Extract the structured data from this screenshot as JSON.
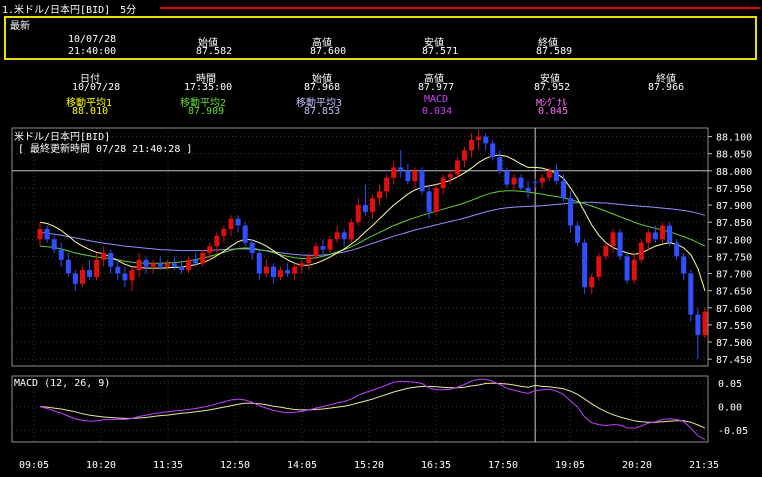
{
  "window": {
    "title": "1.米ドル/日本円[BID]　5分"
  },
  "latest": {
    "label": "最新",
    "date": "10/07/28",
    "time": "21:40:00",
    "open_label": "始値",
    "open": "87.582",
    "high_label": "高値",
    "high": "87.600",
    "low_label": "安値",
    "low": "87.571",
    "close_label": "終値",
    "close": "87.589"
  },
  "cursor_info": {
    "date_label": "日付",
    "date": "10/07/28",
    "time_label": "時間",
    "time": "17:35:00",
    "open_label": "始値",
    "open": "87.968",
    "high_label": "高値",
    "high": "87.977",
    "low_label": "安値",
    "low": "87.952",
    "close_label": "終値",
    "close": "87.966",
    "ma1_label": "移動平均1",
    "ma1": "88.010",
    "ma2_label": "移動平均2",
    "ma2": "87.909",
    "ma3_label": "移動平均3",
    "ma3": "87.853",
    "macd_label": "MACD",
    "macd": "0.034",
    "signal_label": "Mｼｸﾞﾅﾙ",
    "signal": "0.045"
  },
  "colors": {
    "up": "#e01010",
    "down": "#3050ff",
    "ma1": "#ffffa0",
    "ma2": "#60d030",
    "ma3": "#9090ff",
    "macd": "#c040ff",
    "signal": "#e8e8a0",
    "grid": "#333333",
    "axis": "#c0c0c0"
  },
  "chart_data": [
    {
      "type": "candlestick",
      "title": "米ドル/日本円[BID]",
      "subtitle": "[ 最終更新時間 07/28 21:40:28 ]",
      "ylim": [
        87.43,
        88.125
      ],
      "y_ticks": [
        "88.100",
        "88.050",
        "88.000",
        "87.950",
        "87.900",
        "87.850",
        "87.800",
        "87.750",
        "87.700",
        "87.650",
        "87.600",
        "87.550",
        "87.500",
        "87.450"
      ],
      "x_ticks": [
        "09:05",
        "10:20",
        "11:35",
        "12:50",
        "14:05",
        "15:20",
        "16:35",
        "17:50",
        "19:05",
        "20:20",
        "21:35"
      ],
      "reference_line": 88.0,
      "cursor_time": "17:35",
      "ohlc": [
        [
          87.8,
          87.85,
          87.78,
          87.83
        ],
        [
          87.83,
          87.84,
          87.79,
          87.8
        ],
        [
          87.8,
          87.81,
          87.76,
          87.77
        ],
        [
          87.77,
          87.79,
          87.72,
          87.74
        ],
        [
          87.74,
          87.76,
          87.69,
          87.7
        ],
        [
          87.7,
          87.71,
          87.65,
          87.67
        ],
        [
          87.67,
          87.72,
          87.66,
          87.71
        ],
        [
          87.71,
          87.74,
          87.68,
          87.69
        ],
        [
          87.69,
          87.76,
          87.68,
          87.74
        ],
        [
          87.74,
          87.78,
          87.72,
          87.76
        ],
        [
          87.76,
          87.77,
          87.7,
          87.72
        ],
        [
          87.72,
          87.74,
          87.68,
          87.7
        ],
        [
          87.7,
          87.72,
          87.66,
          87.68
        ],
        [
          87.68,
          87.72,
          87.65,
          87.71
        ],
        [
          87.71,
          87.76,
          87.69,
          87.74
        ],
        [
          87.74,
          87.75,
          87.7,
          87.72
        ],
        [
          87.72,
          87.74,
          87.7,
          87.73
        ],
        [
          87.73,
          87.75,
          87.71,
          87.72
        ],
        [
          87.72,
          87.74,
          87.71,
          87.73
        ],
        [
          87.73,
          87.75,
          87.71,
          87.72
        ],
        [
          87.72,
          87.74,
          87.7,
          87.71
        ],
        [
          87.71,
          87.75,
          87.7,
          87.74
        ],
        [
          87.74,
          87.76,
          87.72,
          87.73
        ],
        [
          87.73,
          87.77,
          87.72,
          87.76
        ],
        [
          87.76,
          87.79,
          87.74,
          87.78
        ],
        [
          87.78,
          87.82,
          87.76,
          87.81
        ],
        [
          87.81,
          87.84,
          87.79,
          87.83
        ],
        [
          87.83,
          87.87,
          87.81,
          87.86
        ],
        [
          87.86,
          87.87,
          87.82,
          87.84
        ],
        [
          87.84,
          87.85,
          87.78,
          87.79
        ],
        [
          87.79,
          87.8,
          87.74,
          87.76
        ],
        [
          87.76,
          87.77,
          87.68,
          87.7
        ],
        [
          87.7,
          87.74,
          87.69,
          87.72
        ],
        [
          87.72,
          87.73,
          87.67,
          87.69
        ],
        [
          87.69,
          87.72,
          87.68,
          87.71
        ],
        [
          87.71,
          87.73,
          87.69,
          87.7
        ],
        [
          87.7,
          87.73,
          87.68,
          87.72
        ],
        [
          87.72,
          87.74,
          87.7,
          87.73
        ],
        [
          87.73,
          87.76,
          87.71,
          87.75
        ],
        [
          87.75,
          87.79,
          87.74,
          87.78
        ],
        [
          87.78,
          87.8,
          87.75,
          87.77
        ],
        [
          87.77,
          87.81,
          87.76,
          87.8
        ],
        [
          87.8,
          87.84,
          87.79,
          87.82
        ],
        [
          87.82,
          87.83,
          87.78,
          87.8
        ],
        [
          87.8,
          87.86,
          87.79,
          87.85
        ],
        [
          87.85,
          87.92,
          87.84,
          87.9
        ],
        [
          87.9,
          87.96,
          87.87,
          87.88
        ],
        [
          87.88,
          87.93,
          87.86,
          87.92
        ],
        [
          87.92,
          87.96,
          87.9,
          87.94
        ],
        [
          87.94,
          87.99,
          87.92,
          87.98
        ],
        [
          87.98,
          88.03,
          87.96,
          88.01
        ],
        [
          88.01,
          88.06,
          87.98,
          88.0
        ],
        [
          88.0,
          88.02,
          87.96,
          87.97
        ],
        [
          87.97,
          88.01,
          87.95,
          88.0
        ],
        [
          88.0,
          88.01,
          87.93,
          87.94
        ],
        [
          87.94,
          87.96,
          87.86,
          87.88
        ],
        [
          87.88,
          87.96,
          87.87,
          87.95
        ],
        [
          87.95,
          87.99,
          87.93,
          87.98
        ],
        [
          87.98,
          88.0,
          87.96,
          87.99
        ],
        [
          87.99,
          88.04,
          87.98,
          88.03
        ],
        [
          88.03,
          88.07,
          88.01,
          88.06
        ],
        [
          88.06,
          88.11,
          88.04,
          88.09
        ],
        [
          88.09,
          88.12,
          88.06,
          88.1
        ],
        [
          88.1,
          88.11,
          88.06,
          88.08
        ],
        [
          88.08,
          88.09,
          88.03,
          88.04
        ],
        [
          88.04,
          88.06,
          87.99,
          88.0
        ],
        [
          88.0,
          88.01,
          87.95,
          87.96
        ],
        [
          87.96,
          87.99,
          87.94,
          87.98
        ],
        [
          87.98,
          87.99,
          87.94,
          87.95
        ],
        [
          87.95,
          87.97,
          87.92,
          87.94
        ],
        [
          87.968,
          87.977,
          87.952,
          87.966
        ],
        [
          87.966,
          87.99,
          87.95,
          87.98
        ],
        [
          87.98,
          88.01,
          87.97,
          88.0
        ],
        [
          88.0,
          88.02,
          87.96,
          87.97
        ],
        [
          87.97,
          87.99,
          87.91,
          87.92
        ],
        [
          87.92,
          87.94,
          87.82,
          87.84
        ],
        [
          87.84,
          87.85,
          87.78,
          87.79
        ],
        [
          87.79,
          87.8,
          87.64,
          87.66
        ],
        [
          87.66,
          87.7,
          87.64,
          87.69
        ],
        [
          87.69,
          87.76,
          87.68,
          87.75
        ],
        [
          87.75,
          87.79,
          87.74,
          87.78
        ],
        [
          87.78,
          87.83,
          87.76,
          87.82
        ],
        [
          87.82,
          87.83,
          87.74,
          87.75
        ],
        [
          87.75,
          87.76,
          87.67,
          87.68
        ],
        [
          87.68,
          87.76,
          87.67,
          87.74
        ],
        [
          87.74,
          87.8,
          87.73,
          87.79
        ],
        [
          87.79,
          87.83,
          87.77,
          87.82
        ],
        [
          87.82,
          87.84,
          87.79,
          87.8
        ],
        [
          87.8,
          87.85,
          87.79,
          87.84
        ],
        [
          87.84,
          87.85,
          87.78,
          87.79
        ],
        [
          87.79,
          87.8,
          87.74,
          87.75
        ],
        [
          87.75,
          87.76,
          87.68,
          87.7
        ],
        [
          87.7,
          87.71,
          87.56,
          87.58
        ],
        [
          87.58,
          87.6,
          87.45,
          87.52
        ],
        [
          87.52,
          87.6,
          87.51,
          87.589
        ]
      ],
      "ma1": [
        87.85,
        87.846,
        87.838,
        87.826,
        87.81,
        87.792,
        87.78,
        87.77,
        87.762,
        87.757,
        87.748,
        87.738,
        87.727,
        87.72,
        87.718,
        87.716,
        87.716,
        87.716,
        87.717,
        87.718,
        87.719,
        87.722,
        87.726,
        87.732,
        87.74,
        87.752,
        87.765,
        87.78,
        87.793,
        87.8,
        87.798,
        87.79,
        87.78,
        87.767,
        87.752,
        87.74,
        87.73,
        87.724,
        87.724,
        87.73,
        87.738,
        87.748,
        87.76,
        87.772,
        87.786,
        87.802,
        87.822,
        87.84,
        87.86,
        87.88,
        87.9,
        87.916,
        87.932,
        87.944,
        87.952,
        87.956,
        87.96,
        87.965,
        87.972,
        87.982,
        87.994,
        88.008,
        88.024,
        88.036,
        88.044,
        88.046,
        88.042,
        88.032,
        88.02,
        88.01,
        88.01,
        88.008,
        88.002,
        87.992,
        87.978,
        87.95,
        87.918,
        87.88,
        87.842,
        87.812,
        87.79,
        87.776,
        87.768,
        87.76,
        87.756,
        87.76,
        87.77,
        87.78,
        87.786,
        87.79,
        87.786,
        87.775,
        87.755,
        87.715,
        87.65
      ],
      "ma2": [
        87.78,
        87.778,
        87.776,
        87.772,
        87.766,
        87.76,
        87.756,
        87.752,
        87.748,
        87.746,
        87.743,
        87.74,
        87.736,
        87.733,
        87.731,
        87.73,
        87.73,
        87.73,
        87.731,
        87.732,
        87.734,
        87.737,
        87.741,
        87.745,
        87.75,
        87.756,
        87.762,
        87.768,
        87.773,
        87.775,
        87.774,
        87.77,
        87.766,
        87.761,
        87.755,
        87.75,
        87.746,
        87.744,
        87.744,
        87.746,
        87.75,
        87.756,
        87.763,
        87.77,
        87.778,
        87.788,
        87.8,
        87.81,
        87.82,
        87.83,
        87.84,
        87.848,
        87.856,
        87.863,
        87.87,
        87.876,
        87.882,
        87.888,
        87.894,
        87.9,
        87.906,
        87.914,
        87.922,
        87.93,
        87.936,
        87.94,
        87.942,
        87.942,
        87.94,
        87.938,
        87.935,
        87.932,
        87.928,
        87.925,
        87.921,
        87.916,
        87.91,
        87.904,
        87.897,
        87.89,
        87.882,
        87.874,
        87.866,
        87.858,
        87.85,
        87.843,
        87.837,
        87.832,
        87.827,
        87.822,
        87.815,
        87.808,
        87.8,
        87.79,
        87.78
      ],
      "ma3": [
        87.82,
        87.818,
        87.815,
        87.812,
        87.808,
        87.804,
        87.8,
        87.796,
        87.792,
        87.789,
        87.786,
        87.783,
        87.78,
        87.778,
        87.776,
        87.774,
        87.772,
        87.77,
        87.769,
        87.768,
        87.767,
        87.767,
        87.767,
        87.767,
        87.768,
        87.769,
        87.77,
        87.771,
        87.772,
        87.772,
        87.771,
        87.769,
        87.767,
        87.764,
        87.761,
        87.758,
        87.756,
        87.754,
        87.753,
        87.753,
        87.754,
        87.756,
        87.759,
        87.763,
        87.768,
        87.774,
        87.781,
        87.788,
        87.795,
        87.802,
        87.809,
        87.815,
        87.821,
        87.827,
        87.832,
        87.837,
        87.842,
        87.847,
        87.852,
        87.857,
        87.862,
        87.868,
        87.874,
        87.88,
        87.885,
        87.889,
        87.892,
        87.894,
        87.895,
        87.896,
        87.897,
        87.898,
        87.9,
        87.902,
        87.904,
        87.906,
        87.907,
        87.908,
        87.908,
        87.907,
        87.906,
        87.904,
        87.902,
        87.9,
        87.898,
        87.896,
        87.895,
        87.893,
        87.891,
        87.889,
        87.887,
        87.884,
        87.881,
        87.876,
        87.87
      ]
    },
    {
      "type": "line",
      "title": "MACD (12, 26, 9)",
      "ylim": [
        -0.075,
        0.065
      ],
      "y_ticks": [
        "0.05",
        "0.00",
        "-0.05"
      ],
      "macd": [
        0.0,
        -0.004,
        -0.009,
        -0.014,
        -0.02,
        -0.026,
        -0.029,
        -0.031,
        -0.03,
        -0.028,
        -0.027,
        -0.027,
        -0.027,
        -0.025,
        -0.021,
        -0.018,
        -0.015,
        -0.013,
        -0.011,
        -0.009,
        -0.008,
        -0.006,
        -0.004,
        -0.001,
        0.002,
        0.006,
        0.01,
        0.014,
        0.016,
        0.014,
        0.009,
        0.002,
        -0.003,
        -0.008,
        -0.011,
        -0.013,
        -0.012,
        -0.01,
        -0.007,
        -0.003,
        0.0,
        0.004,
        0.008,
        0.011,
        0.016,
        0.024,
        0.03,
        0.035,
        0.04,
        0.046,
        0.052,
        0.054,
        0.053,
        0.052,
        0.049,
        0.04,
        0.036,
        0.036,
        0.037,
        0.041,
        0.047,
        0.054,
        0.058,
        0.058,
        0.054,
        0.047,
        0.039,
        0.035,
        0.031,
        0.028,
        0.034,
        0.036,
        0.037,
        0.033,
        0.026,
        0.012,
        -0.001,
        -0.022,
        -0.034,
        -0.038,
        -0.04,
        -0.038,
        -0.039,
        -0.045,
        -0.046,
        -0.041,
        -0.035,
        -0.032,
        -0.027,
        -0.026,
        -0.027,
        -0.032,
        -0.045,
        -0.062,
        -0.07
      ],
      "signal": [
        0.0,
        -0.001,
        -0.003,
        -0.005,
        -0.008,
        -0.011,
        -0.015,
        -0.018,
        -0.02,
        -0.022,
        -0.023,
        -0.024,
        -0.025,
        -0.025,
        -0.024,
        -0.023,
        -0.021,
        -0.019,
        -0.018,
        -0.016,
        -0.014,
        -0.013,
        -0.011,
        -0.009,
        -0.007,
        -0.004,
        -0.001,
        0.002,
        0.005,
        0.007,
        0.007,
        0.006,
        0.004,
        0.001,
        -0.001,
        -0.004,
        -0.006,
        -0.007,
        -0.007,
        -0.006,
        -0.005,
        -0.003,
        -0.001,
        0.001,
        0.004,
        0.008,
        0.012,
        0.016,
        0.021,
        0.026,
        0.031,
        0.035,
        0.039,
        0.041,
        0.043,
        0.043,
        0.042,
        0.041,
        0.04,
        0.04,
        0.041,
        0.044,
        0.046,
        0.049,
        0.05,
        0.049,
        0.048,
        0.046,
        0.043,
        0.041,
        0.045,
        0.043,
        0.042,
        0.04,
        0.038,
        0.033,
        0.026,
        0.016,
        0.006,
        -0.003,
        -0.011,
        -0.017,
        -0.022,
        -0.026,
        -0.03,
        -0.032,
        -0.033,
        -0.033,
        -0.032,
        -0.031,
        -0.03,
        -0.03,
        -0.033,
        -0.039,
        -0.045
      ]
    }
  ]
}
